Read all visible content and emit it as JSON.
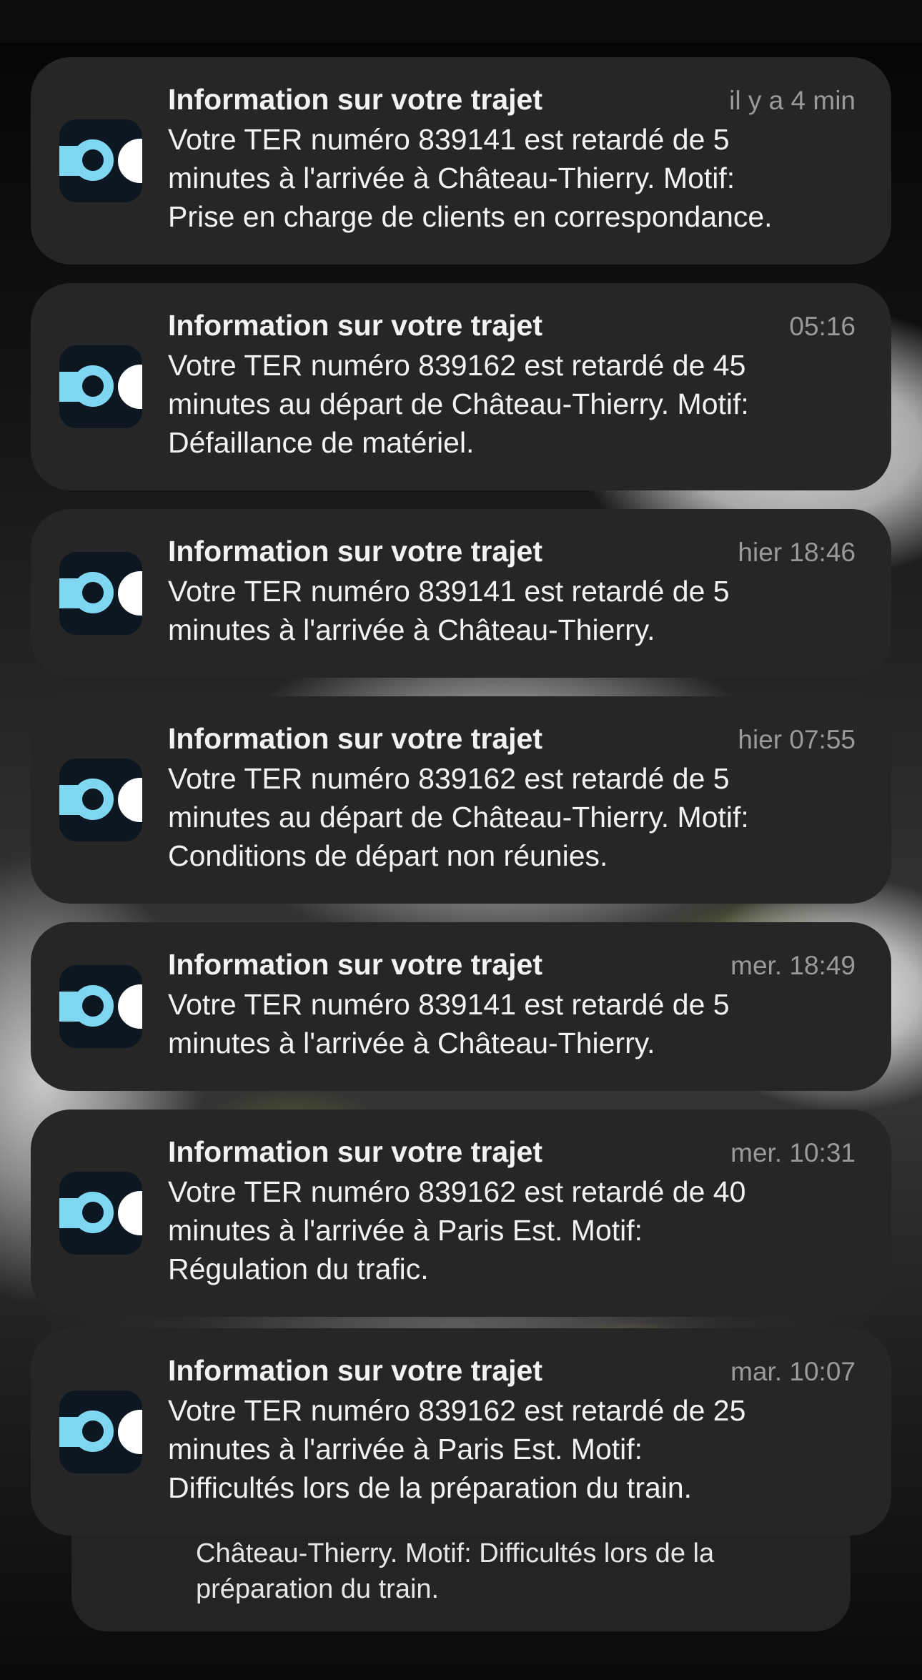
{
  "notifications": [
    {
      "title": "Information sur votre trajet",
      "time": "il y a 4 min",
      "body": "Votre TER numéro 839141 est retardé de 5\nminutes à l'arrivée à Château-Thierry. Motif:\nPrise en charge de clients en correspondance."
    },
    {
      "title": "Information sur votre trajet",
      "time": "05:16",
      "body": "Votre TER numéro 839162 est retardé de 45\nminutes au départ de Château-Thierry. Motif:\nDéfaillance de matériel."
    },
    {
      "title": "Information sur votre trajet",
      "time": "hier 18:46",
      "body": "Votre TER numéro 839141 est retardé de 5\nminutes à l'arrivée à Château-Thierry."
    },
    {
      "title": "Information sur votre trajet",
      "time": "hier 07:55",
      "body": "Votre TER numéro 839162 est retardé de 5\nminutes au départ de Château-Thierry. Motif:\nConditions de départ non réunies."
    },
    {
      "title": "Information sur votre trajet",
      "time": "mer. 18:49",
      "body": "Votre TER numéro 839141 est retardé de 5\nminutes à l'arrivée à Château-Thierry."
    },
    {
      "title": "Information sur votre trajet",
      "time": "mer. 10:31",
      "body": "Votre TER numéro 839162 est retardé de 40\nminutes à l'arrivée à Paris Est. Motif:\nRégulation du trafic."
    },
    {
      "title": "Information sur votre trajet",
      "time": "mar. 10:07",
      "body": "Votre TER numéro 839162 est retardé de 25\nminutes à l'arrivée à Paris Est. Motif:\nDifficultés lors de la préparation du train."
    }
  ],
  "stacked_notification": {
    "body": "Château-Thierry. Motif: Difficultés lors de la\npréparation du train."
  },
  "app_icon": "sncf-connect-app-icon",
  "colors": {
    "card": "#262626",
    "icon_accent": "#7fd6f0",
    "icon_bg": "#0d1722"
  }
}
